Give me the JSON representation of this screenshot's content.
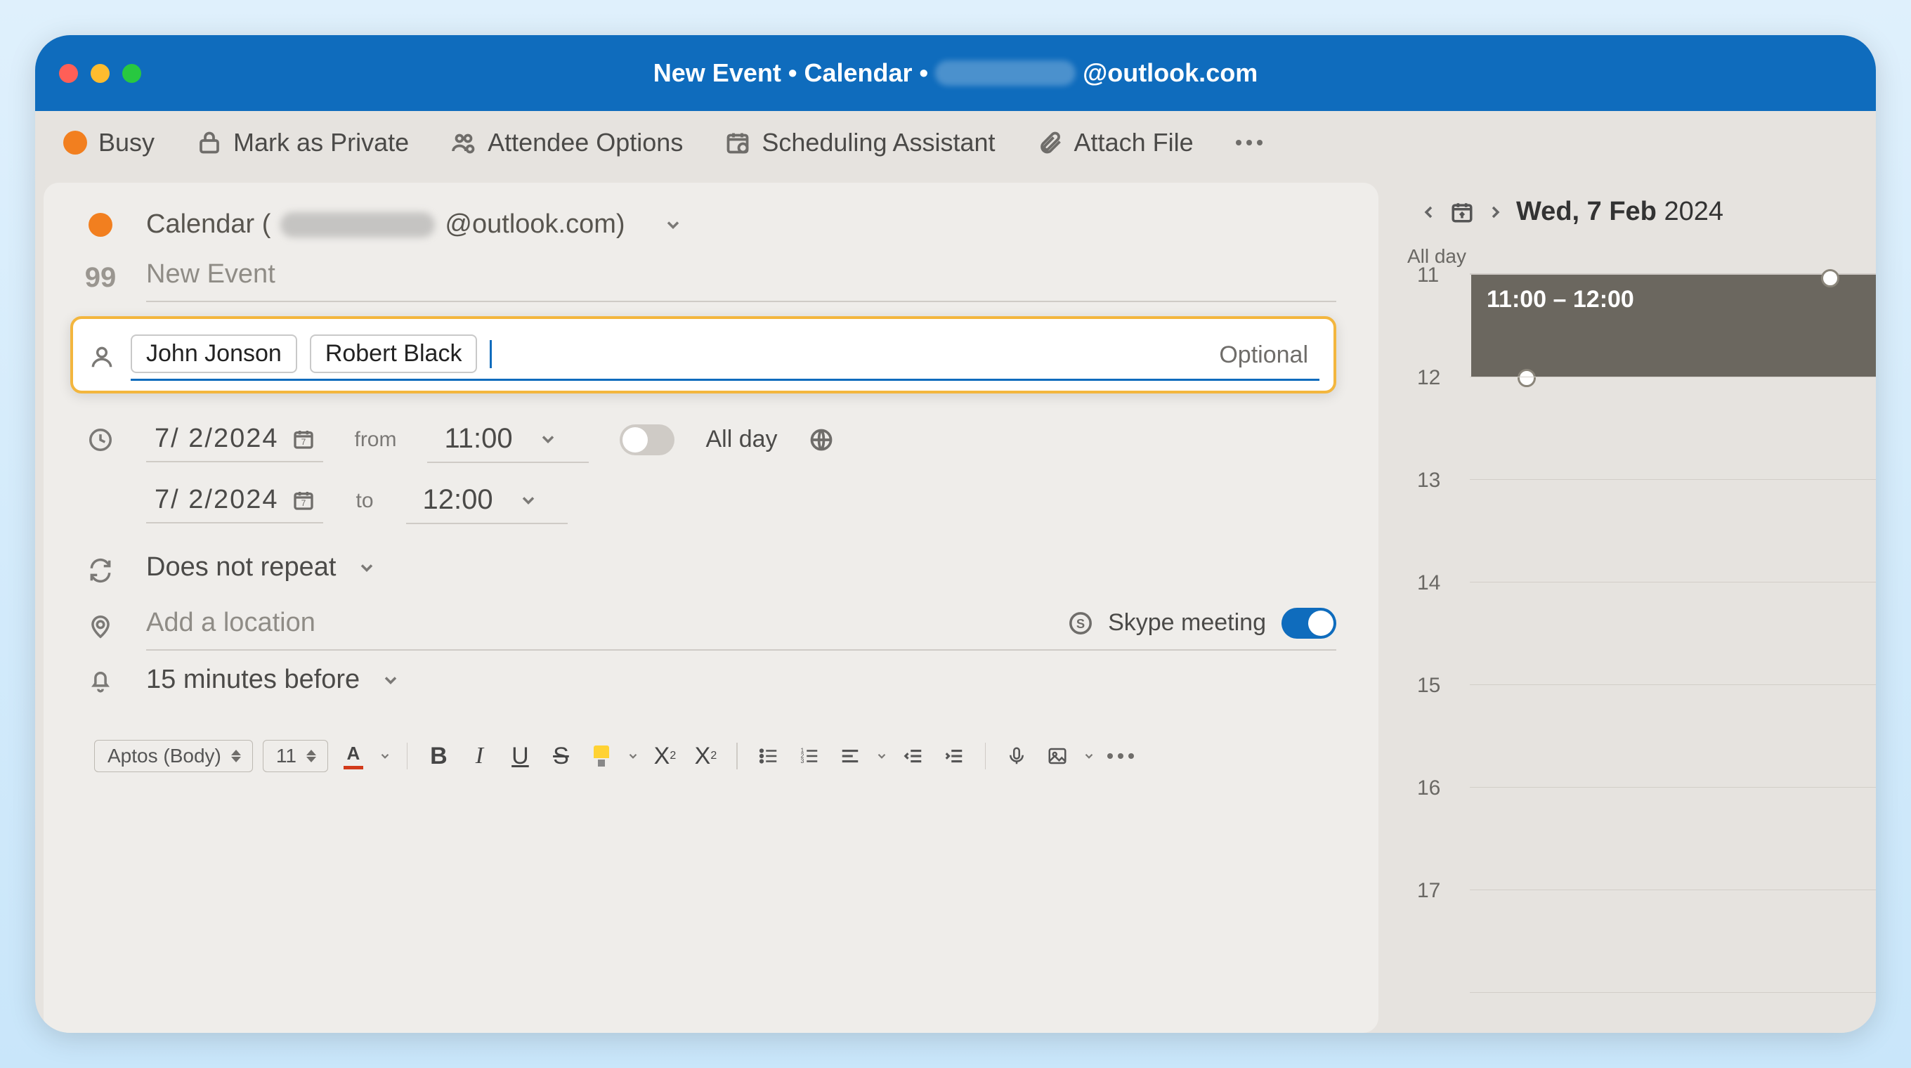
{
  "window": {
    "title_prefix": "New Event • Calendar •",
    "title_suffix": "@outlook.com"
  },
  "toolbar": {
    "busy": "Busy",
    "private": "Mark as Private",
    "attendee_opts": "Attendee Options",
    "scheduling": "Scheduling Assistant",
    "attach": "Attach File"
  },
  "form": {
    "calendar_prefix": "Calendar (",
    "calendar_suffix": "@outlook.com)",
    "event_title_placeholder": "New Event",
    "attendees": [
      "John Jonson",
      "Robert Black"
    ],
    "optional_label": "Optional",
    "start_date": "7/ 2/2024",
    "end_date": "7/ 2/2024",
    "start_time": "11:00",
    "end_time": "12:00",
    "label_from": "from",
    "label_to": "to",
    "all_day": "All day",
    "repeat": "Does not repeat",
    "location_placeholder": "Add a location",
    "skype": "Skype meeting",
    "reminder": "15 minutes before"
  },
  "editor": {
    "font_name": "Aptos (Body)",
    "font_size": "11"
  },
  "day_panel": {
    "date_bold": "Wed, 7 Feb",
    "date_year": " 2024",
    "all_day": "All day",
    "hours": [
      "11",
      "12",
      "13",
      "14",
      "15",
      "16",
      "17"
    ],
    "event_time": "11:00 – 12:00"
  }
}
